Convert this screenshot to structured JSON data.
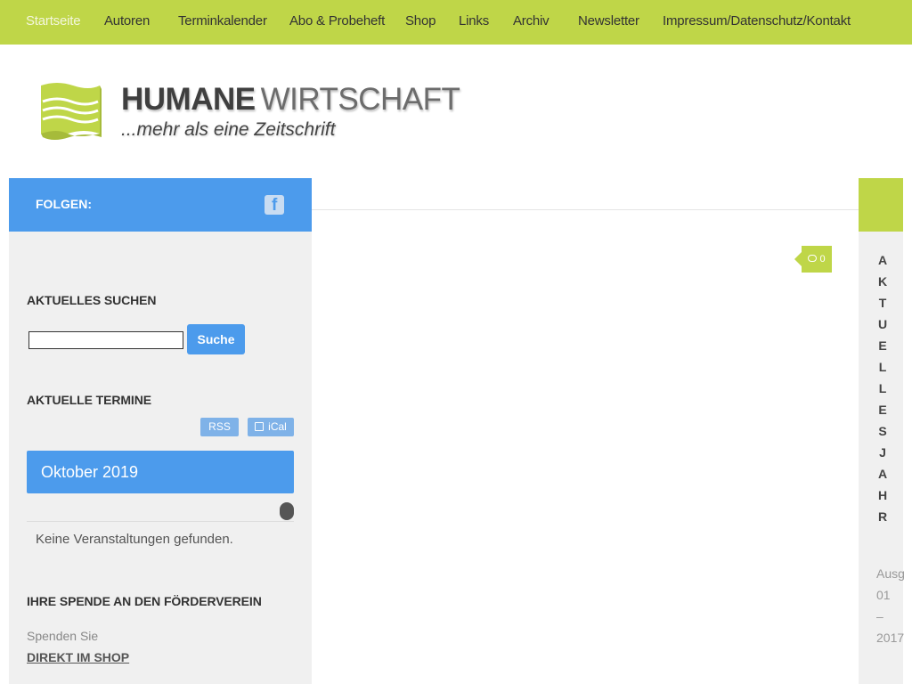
{
  "nav": {
    "items": [
      {
        "label": "Startseite"
      },
      {
        "label": "Autoren"
      },
      {
        "label": "Terminkalender"
      },
      {
        "label": "Abo & Probeheft"
      },
      {
        "label": "Shop"
      },
      {
        "label": "Links"
      },
      {
        "label": "Archiv"
      },
      {
        "label": "Newsletter"
      },
      {
        "label": "Impressum/Datenschutz/Kontakt"
      }
    ]
  },
  "header": {
    "title_bold": "HUMANE",
    "title_light": "WIRTSCHAFT",
    "subtitle": "...mehr als eine Zeitschrift"
  },
  "sidebar": {
    "follow_label": "FOLGEN:",
    "search": {
      "title": "AKTUELLES SUCHEN",
      "value": "",
      "button_label": "Suche"
    },
    "events": {
      "title": "AKTUELLE TERMINE",
      "rss_label": "RSS",
      "ical_label": "iCal",
      "month": "Oktober 2019",
      "empty_text": "Keine Veranstaltungen gefunden."
    },
    "donate": {
      "title": "IHRE SPENDE AN DEN FÖRDERVEREIN",
      "text": "Spenden Sie",
      "link": "DIREKT IM SHOP"
    }
  },
  "main": {
    "comment_count": "0"
  },
  "right_sidebar": {
    "vertical_title": [
      "A",
      "K",
      "T",
      "U",
      "E",
      "L",
      "L",
      "E",
      "S",
      "J",
      "A",
      "H",
      "R"
    ],
    "meta": [
      "Ausg",
      "01",
      "–",
      "2017"
    ]
  },
  "colors": {
    "accent_green": "#bfd648",
    "accent_blue": "#4c9bec",
    "sidebar_bg": "#f0f0f0"
  }
}
